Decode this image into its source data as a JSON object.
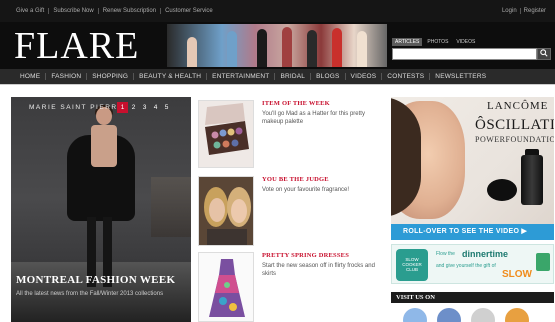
{
  "topbar": {
    "links": [
      "Give a Gift",
      "Subscribe Now",
      "Renew Subscription",
      "Customer Service"
    ],
    "account": [
      "Login",
      "Register"
    ]
  },
  "masthead": {
    "logo": "FLARE",
    "search_tabs": [
      "ARTICLES",
      "PHOTOS",
      "VIDEOS"
    ]
  },
  "nav": {
    "items": [
      "HOME",
      "FASHION",
      "SHOPPING",
      "BEAUTY & HEALTH",
      "ENTERTAINMENT",
      "BRIDAL",
      "BLOGS",
      "VIDEOS",
      "CONTESTS",
      "NEWSLETTERS"
    ]
  },
  "hero": {
    "label": "MARIE SAINT PIERRE",
    "pages": [
      "1",
      "2",
      "3",
      "4",
      "5"
    ],
    "active_page": "1",
    "title": "MONTREAL FASHION WEEK",
    "subtitle": "All the latest news from the Fall/Winter 2013 collections"
  },
  "features": [
    {
      "title": "ITEM OF THE WEEK",
      "desc": "You'll go Mad as a Hatter for this pretty makeup palette"
    },
    {
      "title": "YOU BE THE JUDGE",
      "desc": "Vote on your favourite fragrance!"
    },
    {
      "title": "PRETTY SPRING DRESSES",
      "desc": "Start the new season off in flirty frocks and skirts"
    }
  ],
  "ad": {
    "brand": "LANCÔME",
    "product_line1": "ÔSCILLATION",
    "product_line2": "POWERFOUNDATION",
    "cta": "ROLL-OVER TO SEE THE VIDEO ▶"
  },
  "ad2": {
    "badge": "SLOW COOKER CLUB",
    "line1": "Flow the",
    "brand": "dinnertime",
    "line3": "and give yourself the gift of",
    "highlight": "SLOW"
  },
  "visit": {
    "title": "VISIT US ON"
  },
  "colors": {
    "accent": "#c8102e",
    "cta_blue": "#2d9bd6",
    "nav_bg": "#2a2a2a"
  }
}
